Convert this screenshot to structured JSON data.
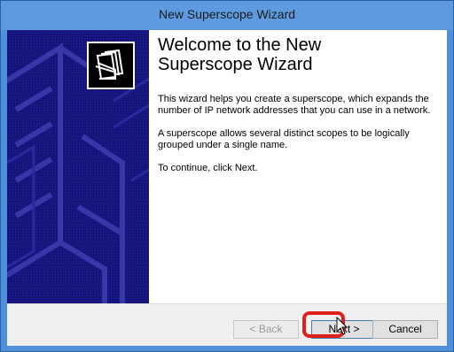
{
  "window": {
    "title": "New Superscope Wizard"
  },
  "wizard": {
    "heading": "Welcome to the New Superscope Wizard",
    "paragraphs": [
      "This wizard helps you create a superscope, which expands the number of IP network addresses that you can use in a network.",
      "A superscope allows several distinct scopes to be logically grouped under a single name.",
      "To continue, click Next."
    ]
  },
  "buttons": {
    "back": "< Back",
    "next": "Next >",
    "cancel": "Cancel"
  },
  "colors": {
    "title_bar": "#5d9ae0",
    "side_panel": "#14147a",
    "highlight": "#e0201a"
  },
  "icons": {
    "wizard_logo": "folders-icon",
    "cursor": "pointer-cursor-icon"
  }
}
